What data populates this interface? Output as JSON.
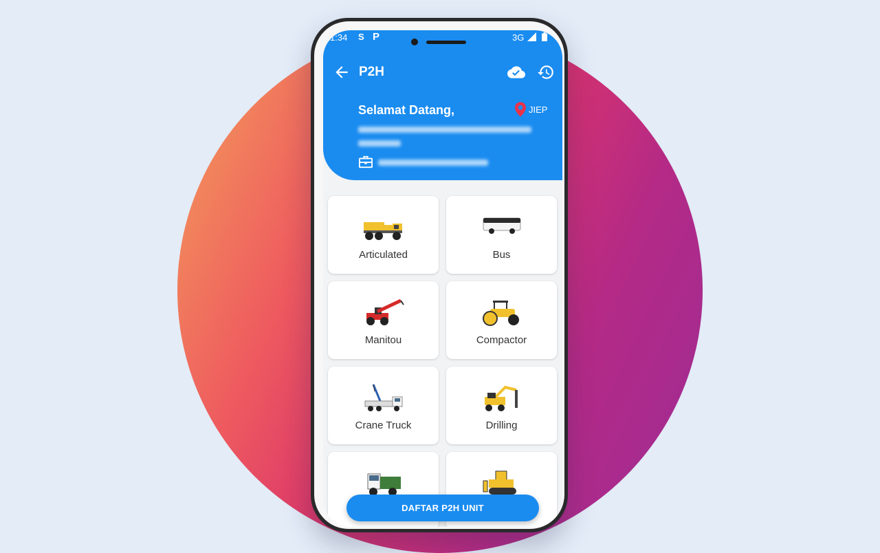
{
  "status_bar": {
    "time": "1:34",
    "icon_s": "S",
    "icon_p": "P",
    "network": "3G"
  },
  "app_bar": {
    "title": "P2H",
    "back_icon": "arrow-left-icon",
    "cloud_icon": "cloud-check-icon",
    "history_icon": "history-icon"
  },
  "greeting": {
    "title": "Selamat Datang,",
    "location": "JIEP",
    "location_icon": "map-pin-icon",
    "company_icon": "briefcase-icon"
  },
  "units": [
    {
      "label": "Articulated",
      "icon": "articulated-truck-icon"
    },
    {
      "label": "Bus",
      "icon": "bus-icon"
    },
    {
      "label": "Manitou",
      "icon": "telehandler-icon"
    },
    {
      "label": "Compactor",
      "icon": "road-roller-icon"
    },
    {
      "label": "Crane Truck",
      "icon": "crane-truck-icon"
    },
    {
      "label": "Drilling",
      "icon": "drilling-rig-icon"
    },
    {
      "label": "",
      "icon": "dump-truck-icon"
    },
    {
      "label": "",
      "icon": "bulldozer-icon"
    }
  ],
  "cta": {
    "label": "DAFTAR P2H UNIT"
  },
  "colors": {
    "primary": "#1a8cf0",
    "pin": "#e8334a",
    "background": "#e3ecf7"
  }
}
